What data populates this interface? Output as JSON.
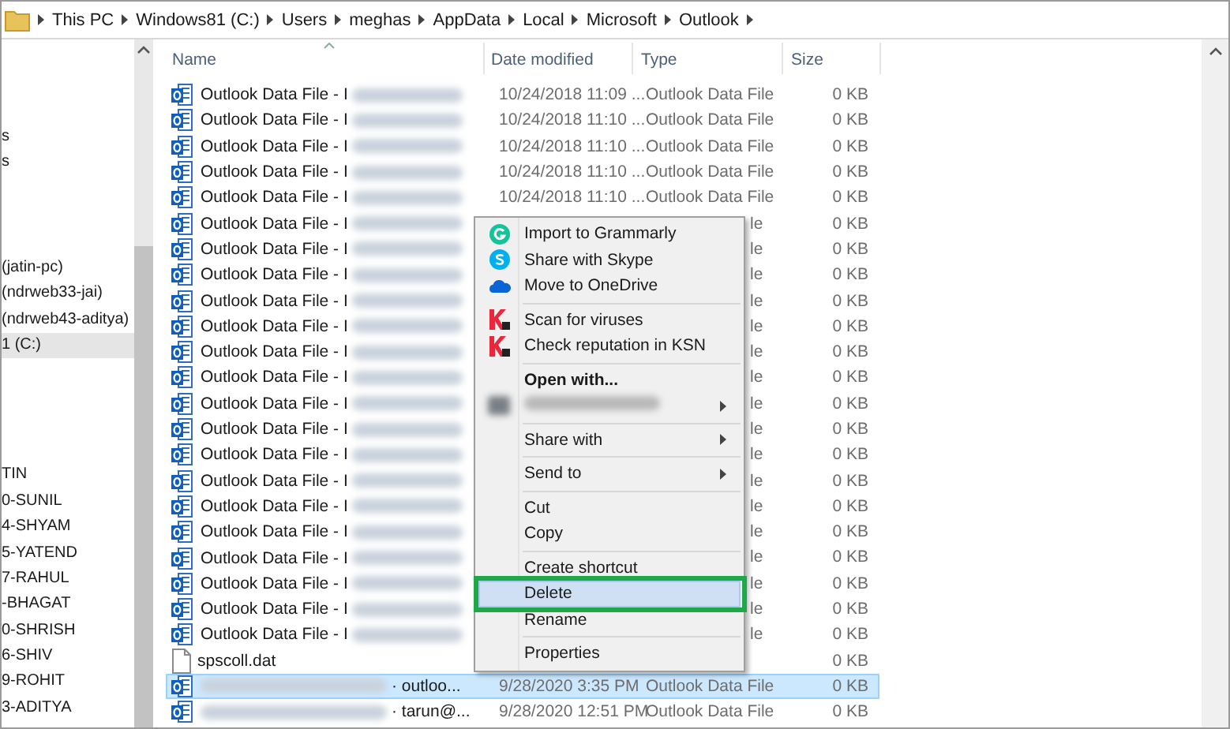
{
  "breadcrumb": [
    "This PC",
    "Windows81 (C:)",
    "Users",
    "meghas",
    "AppData",
    "Local",
    "Microsoft",
    "Outlook"
  ],
  "nav_items": [
    {
      "label": "s",
      "selected": false
    },
    {
      "label": "s",
      "selected": false
    },
    {
      "label": "(jatin-pc)",
      "selected": false
    },
    {
      "label": "(ndrweb33-jai)",
      "selected": false
    },
    {
      "label": "(ndrweb43-aditya)",
      "selected": false
    },
    {
      "label": "1 (C:)",
      "selected": true
    },
    {
      "label": "TIN",
      "selected": false
    },
    {
      "label": "0-SUNIL",
      "selected": false
    },
    {
      "label": "4-SHYAM",
      "selected": false
    },
    {
      "label": "5-YATEND",
      "selected": false
    },
    {
      "label": "7-RAHUL",
      "selected": false
    },
    {
      "label": "-BHAGAT",
      "selected": false
    },
    {
      "label": "0-SHRISH",
      "selected": false
    },
    {
      "label": "6-SHIV",
      "selected": false
    },
    {
      "label": "9-ROHIT",
      "selected": false
    },
    {
      "label": "3-ADITYA",
      "selected": false
    }
  ],
  "columns": [
    "Name",
    "Date modified",
    "Type",
    "Size"
  ],
  "rows": [
    {
      "kind": "pst",
      "name": "Outlook Data File - I",
      "date": "10/24/2018 11:09 ...",
      "type": "Outlook Data File",
      "size": "0 KB",
      "selected": false
    },
    {
      "kind": "pst",
      "name": "Outlook Data File - I",
      "date": "10/24/2018 11:10 ...",
      "type": "Outlook Data File",
      "size": "0 KB",
      "selected": false
    },
    {
      "kind": "pst",
      "name": "Outlook Data File - I",
      "date": "10/24/2018 11:10 ...",
      "type": "Outlook Data File",
      "size": "0 KB",
      "selected": false
    },
    {
      "kind": "pst",
      "name": "Outlook Data File - I",
      "date": "10/24/2018 11:10 ...",
      "type": "Outlook Data File",
      "size": "0 KB",
      "selected": false
    },
    {
      "kind": "pst",
      "name": "Outlook Data File - I",
      "date": "10/24/2018 11:10 ...",
      "type": "Outlook Data File",
      "size": "0 KB",
      "selected": false
    },
    {
      "kind": "pst",
      "name": "Outlook Data File - I",
      "type": "le",
      "size": "0 KB",
      "selected": false,
      "covered": true
    },
    {
      "kind": "pst",
      "name": "Outlook Data File - I",
      "type": "le",
      "size": "0 KB",
      "selected": false,
      "covered": true
    },
    {
      "kind": "pst",
      "name": "Outlook Data File - I",
      "type": "le",
      "size": "0 KB",
      "selected": false,
      "covered": true
    },
    {
      "kind": "pst",
      "name": "Outlook Data File - I",
      "type": "le",
      "size": "0 KB",
      "selected": false,
      "covered": true
    },
    {
      "kind": "pst",
      "name": "Outlook Data File - I",
      "type": "le",
      "size": "0 KB",
      "selected": false,
      "covered": true
    },
    {
      "kind": "pst",
      "name": "Outlook Data File - I",
      "type": "le",
      "size": "0 KB",
      "selected": false,
      "covered": true
    },
    {
      "kind": "pst",
      "name": "Outlook Data File - I",
      "type": "le",
      "size": "0 KB",
      "selected": false,
      "covered": true
    },
    {
      "kind": "pst",
      "name": "Outlook Data File - I",
      "type": "le",
      "size": "0 KB",
      "selected": false,
      "covered": true
    },
    {
      "kind": "pst",
      "name": "Outlook Data File - I",
      "type": "le",
      "size": "0 KB",
      "selected": false,
      "covered": true
    },
    {
      "kind": "pst",
      "name": "Outlook Data File - I",
      "type": "le",
      "size": "0 KB",
      "selected": false,
      "covered": true
    },
    {
      "kind": "pst",
      "name": "Outlook Data File - I",
      "type": "le",
      "size": "0 KB",
      "selected": false,
      "covered": true
    },
    {
      "kind": "pst",
      "name": "Outlook Data File - I",
      "type": "le",
      "size": "0 KB",
      "selected": false,
      "covered": true
    },
    {
      "kind": "pst",
      "name": "Outlook Data File - I",
      "type": "le",
      "size": "0 KB",
      "selected": false,
      "covered": true
    },
    {
      "kind": "pst",
      "name": "Outlook Data File - I",
      "type": "le",
      "size": "0 KB",
      "selected": false,
      "covered": true
    },
    {
      "kind": "pst",
      "name": "Outlook Data File - I",
      "type": "le",
      "size": "0 KB",
      "selected": false,
      "covered": true
    },
    {
      "kind": "pst",
      "name": "Outlook Data File - I",
      "type": "le",
      "size": "0 KB",
      "selected": false,
      "covered": true
    },
    {
      "kind": "pst",
      "name": "Outlook Data File - I",
      "type": "le",
      "size": "0 KB",
      "selected": false,
      "covered": true
    },
    {
      "kind": "file",
      "name": "spscoll.dat",
      "size": "0 KB",
      "selected": false
    },
    {
      "kind": "pst_hidden",
      "name": "· outloo...",
      "date": "9/28/2020 3:35 PM",
      "type": "Outlook Data File",
      "size": "0 KB",
      "selected": true
    },
    {
      "kind": "pst_hidden",
      "name": "· tarun@...",
      "date": "9/28/2020 12:51 PM",
      "type": "Outlook Data File",
      "size": "0 KB",
      "selected": false
    }
  ],
  "context_menu": [
    {
      "kind": "item",
      "label": "Import to Grammarly"
    },
    {
      "kind": "item",
      "label": "Share with Skype"
    },
    {
      "kind": "item",
      "label": "Move to OneDrive"
    },
    {
      "kind": "separator"
    },
    {
      "kind": "item",
      "label": "Scan for viruses"
    },
    {
      "kind": "item",
      "label": "Check reputation in KSN"
    },
    {
      "kind": "separator"
    },
    {
      "kind": "item",
      "label": "Open with...",
      "bold": true
    },
    {
      "kind": "redacted",
      "submenu": true
    },
    {
      "kind": "separator"
    },
    {
      "kind": "item",
      "label": "Share with",
      "submenu": true
    },
    {
      "kind": "separator"
    },
    {
      "kind": "item",
      "label": "Send to",
      "submenu": true
    },
    {
      "kind": "separator"
    },
    {
      "kind": "item",
      "label": "Cut"
    },
    {
      "kind": "item",
      "label": "Copy"
    },
    {
      "kind": "separator"
    },
    {
      "kind": "item",
      "label": "Create shortcut"
    },
    {
      "kind": "item",
      "label": "Delete",
      "selected": true,
      "outlined": true
    },
    {
      "kind": "item",
      "label": "Rename"
    },
    {
      "kind": "separator"
    },
    {
      "kind": "item",
      "label": "Properties"
    }
  ]
}
